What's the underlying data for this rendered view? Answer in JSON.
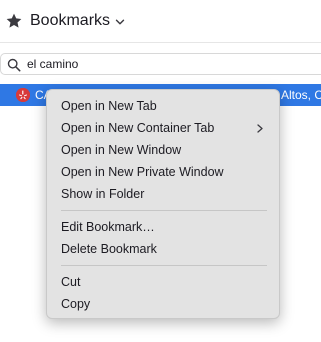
{
  "header": {
    "title": "Bookmarks",
    "star_icon": "star-icon",
    "chevron_icon": "chevron-down-icon"
  },
  "search": {
    "value": "el camino",
    "icon": "search-icon"
  },
  "results": {
    "selected_row": {
      "title": "CA",
      "location": "Altos, C",
      "favicon": "yelp-favicon-icon",
      "highlight_color": "#2f78e4"
    }
  },
  "context_menu": {
    "items": [
      {
        "label": "Open in New Tab"
      },
      {
        "label": "Open in New Container Tab",
        "submenu_icon": "chevron-right-icon"
      },
      {
        "label": "Open in New Window"
      },
      {
        "label": "Open in New Private Window"
      },
      {
        "label": "Show in Folder"
      },
      {
        "label": "Edit Bookmark…"
      },
      {
        "label": "Delete Bookmark"
      },
      {
        "label": "Cut"
      },
      {
        "label": "Copy"
      }
    ]
  }
}
